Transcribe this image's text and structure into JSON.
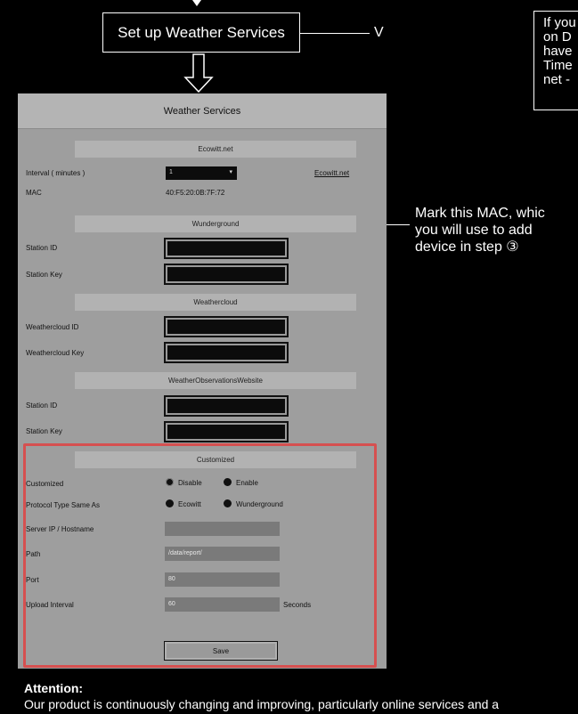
{
  "flow": {
    "step_label": "Set up Weather Services",
    "step_marker": "V"
  },
  "side_notes": {
    "top_right_lines": [
      "If you",
      "on D",
      "have",
      "Time",
      "net -"
    ],
    "mac_note": "Mark this MAC, whic\nyou will use to add\ndevice in step ③"
  },
  "screen": {
    "title": "Weather Services",
    "ecowitt": {
      "header": "Ecowitt.net",
      "interval_label": "Interval ( minutes )",
      "interval_value": "1",
      "link_text": "Ecowitt.net",
      "mac_label": "MAC",
      "mac_value": "40:F5:20:0B:7F:72"
    },
    "wunderground": {
      "header": "Wunderground",
      "id_label": "Station ID",
      "key_label": "Station Key"
    },
    "weathercloud": {
      "header": "Weathercloud",
      "id_label": "Weathercloud ID",
      "key_label": "Weathercloud Key"
    },
    "wow": {
      "header": "WeatherObservationsWebsite",
      "id_label": "Station ID",
      "key_label": "Station Key"
    },
    "customized": {
      "header": "Customized",
      "customized_label": "Customized",
      "disable_label": "Disable",
      "enable_label": "Enable",
      "selected_mode": "Disable",
      "protocol_label": "Protocol Type Same As",
      "protocol_options": [
        "Ecowitt",
        "Wunderground"
      ],
      "server_label": "Server IP / Hostname",
      "server_value": "",
      "path_label": "Path",
      "path_value": "/data/report/",
      "port_label": "Port",
      "port_value": "80",
      "interval_label": "Upload Interval",
      "interval_value": "60",
      "interval_unit": "Seconds",
      "save_label": "Save"
    }
  },
  "attention": {
    "title": "Attention:",
    "body": "Our product is continuously changing and improving, particularly online services and a"
  },
  "colors": {
    "highlight": "#d65050",
    "panel": "#9e9e9e",
    "background": "#000000"
  }
}
